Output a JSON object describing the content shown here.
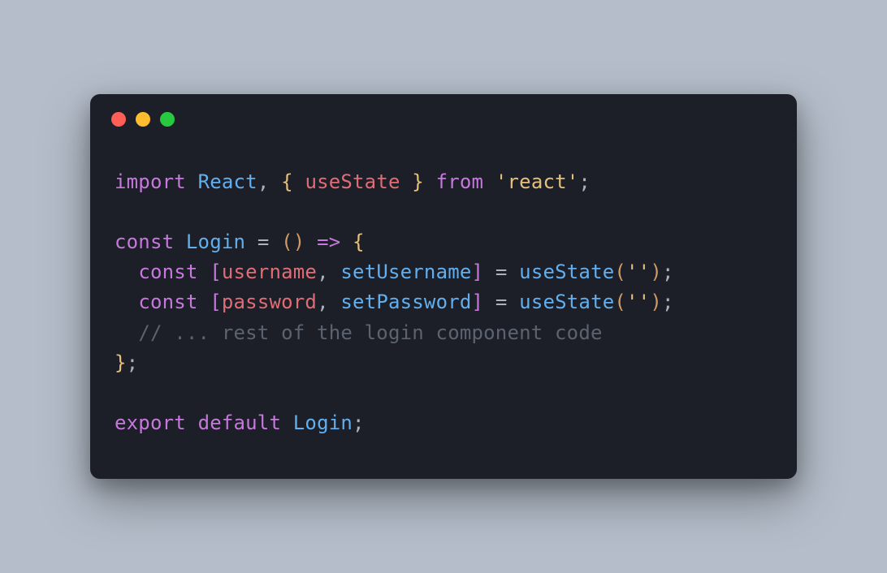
{
  "window": {
    "traffic_lights": [
      "close",
      "minimize",
      "zoom"
    ]
  },
  "code": {
    "line1": {
      "t1": "import",
      "t2": "React",
      "t3": ",",
      "t4": "{",
      "t5": "useState",
      "t6": "}",
      "t7": "from",
      "t8": "'react'",
      "t9": ";"
    },
    "line3": {
      "t1": "const",
      "t2": "Login",
      "t3": "=",
      "t4": "(",
      "t5": ")",
      "t6": "=>",
      "t7": "{"
    },
    "line4": {
      "t1": "const",
      "t2": "[",
      "t3": "username",
      "t4": ",",
      "t5": "setUsername",
      "t6": "]",
      "t7": "=",
      "t8": "useState",
      "t9": "(",
      "t10": "''",
      "t11": ")",
      "t12": ";"
    },
    "line5": {
      "t1": "const",
      "t2": "[",
      "t3": "password",
      "t4": ",",
      "t5": "setPassword",
      "t6": "]",
      "t7": "=",
      "t8": "useState",
      "t9": "(",
      "t10": "''",
      "t11": ")",
      "t12": ";"
    },
    "line6": {
      "t1": "// ... rest of the login component code"
    },
    "line7": {
      "t1": "}",
      "t2": ";"
    },
    "line9": {
      "t1": "export",
      "t2": "default",
      "t3": "Login",
      "t4": ";"
    }
  }
}
